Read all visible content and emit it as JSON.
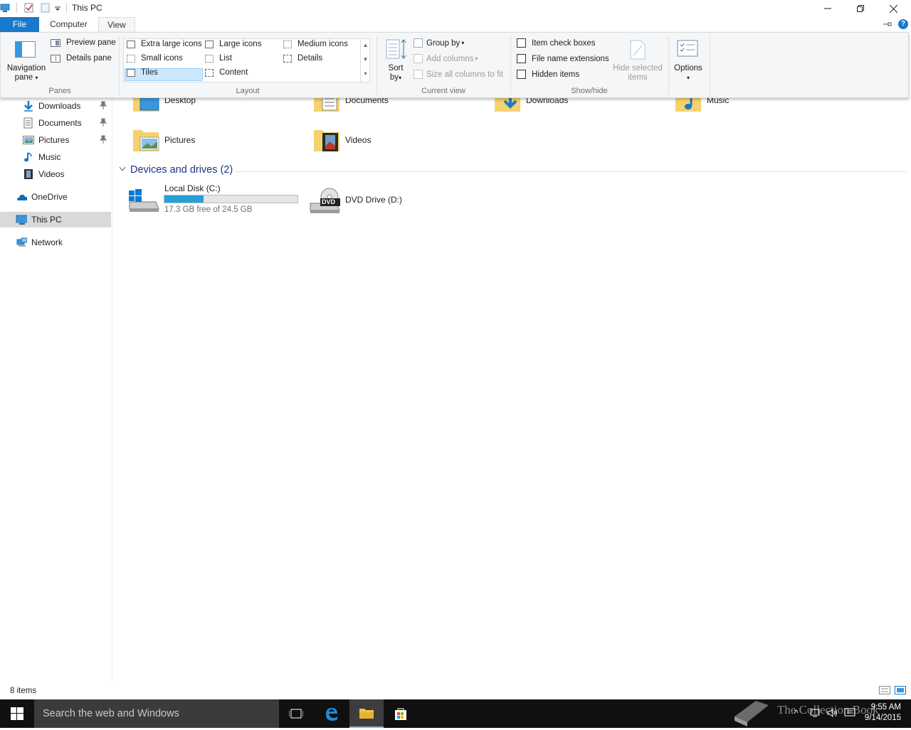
{
  "window": {
    "title": "This PC"
  },
  "tabs": {
    "file": "File",
    "computer": "Computer",
    "view": "View"
  },
  "ribbon": {
    "panes": {
      "navigation_pane_line1": "Navigation",
      "navigation_pane_line2": "pane",
      "preview_pane": "Preview pane",
      "details_pane": "Details pane",
      "group_label": "Panes"
    },
    "layout": {
      "extra_large_icons": "Extra large icons",
      "large_icons": "Large icons",
      "medium_icons": "Medium icons",
      "small_icons": "Small icons",
      "list": "List",
      "details": "Details",
      "tiles": "Tiles",
      "content": "Content",
      "selected": "Tiles",
      "group_label": "Layout"
    },
    "current_view": {
      "sort_by_line1": "Sort",
      "sort_by_line2": "by",
      "group_by": "Group by",
      "add_columns": "Add columns",
      "size_all_columns": "Size all columns to fit",
      "group_label": "Current view"
    },
    "show_hide": {
      "item_check_boxes": "Item check boxes",
      "file_name_extensions": "File name extensions",
      "hidden_items": "Hidden items",
      "hide_selected_line1": "Hide selected",
      "hide_selected_line2": "items",
      "group_label": "Show/hide"
    },
    "options": {
      "label": "Options"
    }
  },
  "nav": {
    "items": [
      {
        "label": "Downloads",
        "icon": "download-arrow-icon",
        "pinned": true
      },
      {
        "label": "Documents",
        "icon": "document-icon",
        "pinned": true
      },
      {
        "label": "Pictures",
        "icon": "picture-icon",
        "pinned": true
      },
      {
        "label": "Music",
        "icon": "music-note-icon",
        "pinned": false
      },
      {
        "label": "Videos",
        "icon": "film-icon",
        "pinned": false
      },
      {
        "label": "OneDrive",
        "icon": "cloud-icon",
        "pinned": false
      },
      {
        "label": "This PC",
        "icon": "computer-icon",
        "pinned": false,
        "selected": true
      },
      {
        "label": "Network",
        "icon": "network-icon",
        "pinned": false
      }
    ]
  },
  "content": {
    "folders": [
      {
        "label": "Desktop",
        "icon": "desktop-folder-icon"
      },
      {
        "label": "Documents",
        "icon": "documents-folder-icon"
      },
      {
        "label": "Downloads",
        "icon": "downloads-folder-icon"
      },
      {
        "label": "Music",
        "icon": "music-folder-icon"
      },
      {
        "label": "Pictures",
        "icon": "pictures-folder-icon"
      },
      {
        "label": "Videos",
        "icon": "videos-folder-icon"
      }
    ],
    "devices_header": "Devices and drives (2)",
    "drives": [
      {
        "label": "Local Disk (C:)",
        "free_text": "17.3 GB free of 24.5 GB",
        "used_fraction": 0.294,
        "icon": "windows-drive-icon"
      },
      {
        "label": "DVD Drive (D:)",
        "icon": "dvd-drive-icon",
        "badge": "DVD"
      }
    ]
  },
  "status": {
    "item_count": "8 items"
  },
  "taskbar": {
    "search_placeholder": "Search the web and Windows",
    "time": "9:55 AM",
    "date": "9/14/2015",
    "watermark": "The Collection Book"
  },
  "colors": {
    "accent": "#1979ca",
    "drive_fill": "#26a0da",
    "group_header": "#1e3287"
  }
}
